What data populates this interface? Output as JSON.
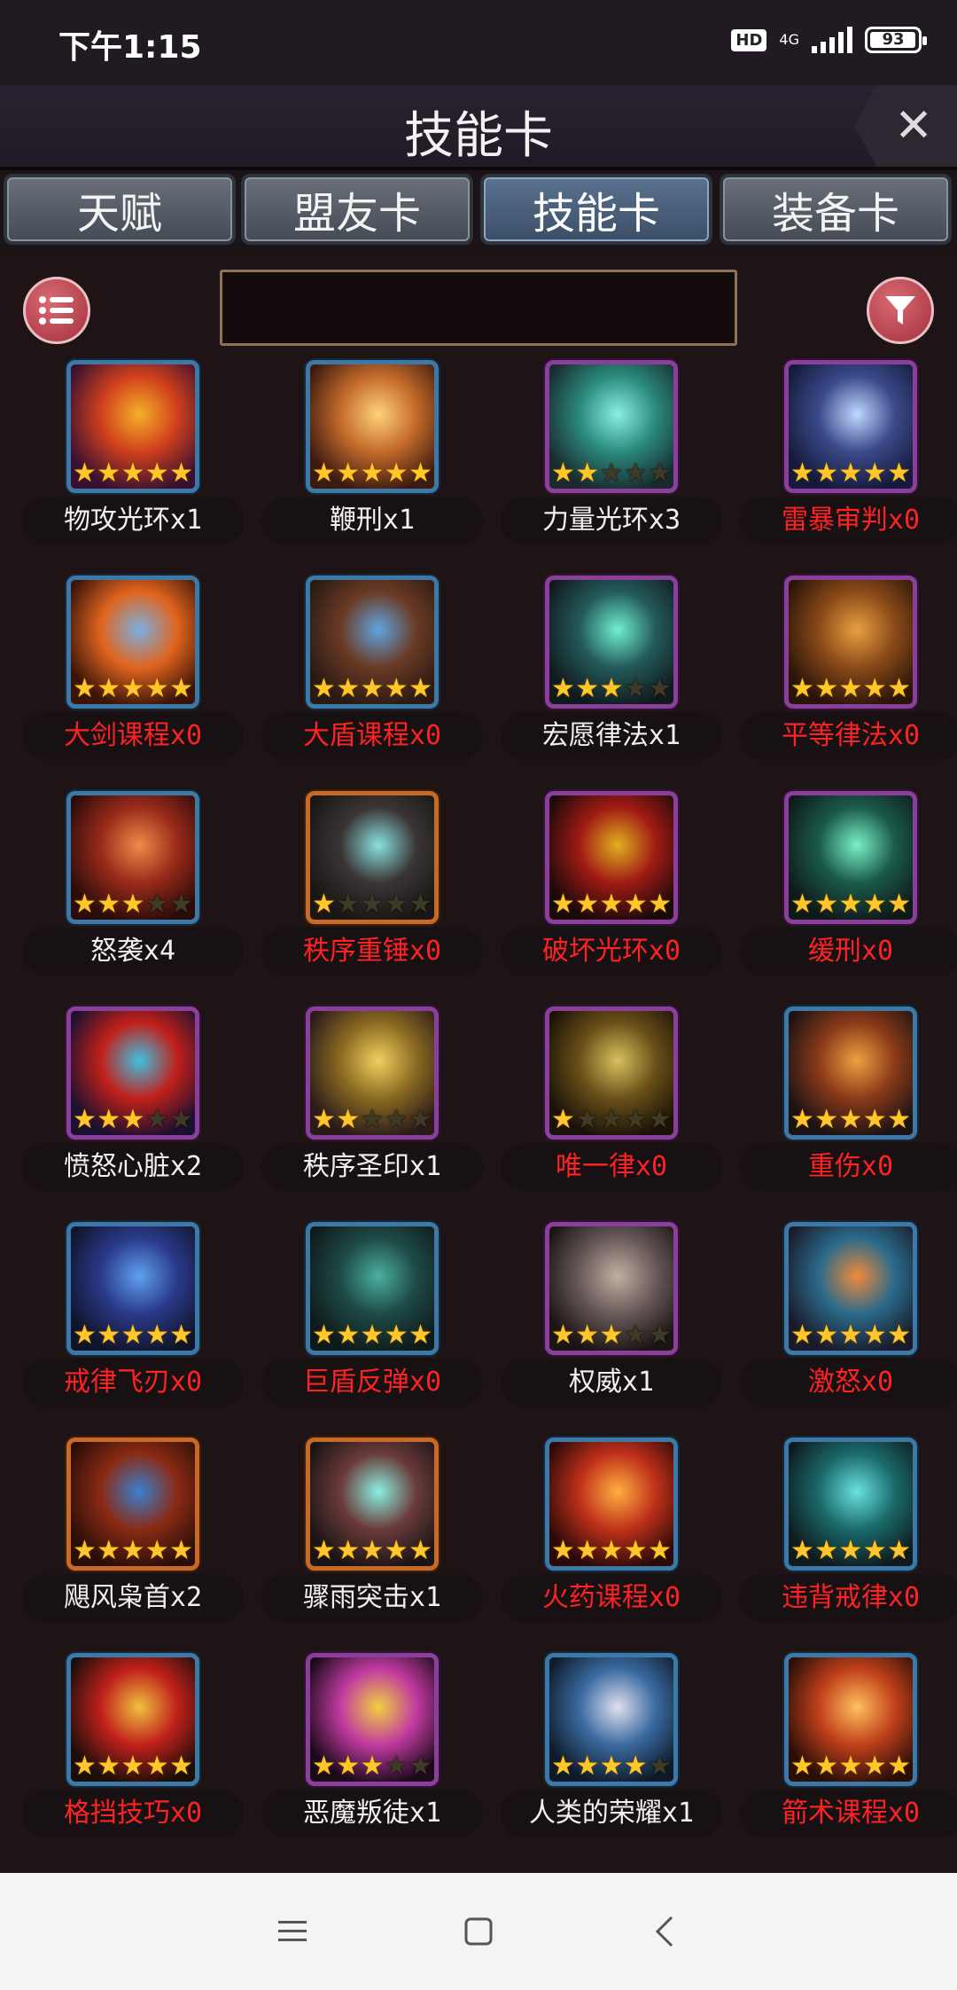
{
  "status": {
    "time": "下午1:15",
    "hd": "HD",
    "network": "4G",
    "battery": "93"
  },
  "header": {
    "title": "技能卡"
  },
  "tabs": [
    {
      "label": "天赋",
      "active": false
    },
    {
      "label": "盟友卡",
      "active": false
    },
    {
      "label": "技能卡",
      "active": true
    },
    {
      "label": "装备卡",
      "active": false
    }
  ],
  "search": {
    "value": ""
  },
  "cards": [
    {
      "name": "物攻光环x1",
      "stars": 5,
      "frame": "blue",
      "owned": true,
      "colors": [
        "#3a1030",
        "#d0401c",
        "#f5b02a"
      ]
    },
    {
      "name": "鞭刑x1",
      "stars": 5,
      "frame": "blue",
      "owned": true,
      "colors": [
        "#3b1a10",
        "#c46a2a",
        "#ffd27a"
      ]
    },
    {
      "name": "力量光环x3",
      "stars": 2,
      "frame": "purple",
      "owned": true,
      "colors": [
        "#1a2a2e",
        "#2a8a7e",
        "#8af0e4"
      ]
    },
    {
      "name": "雷暴审判x0",
      "stars": 5,
      "frame": "purple",
      "owned": false,
      "colors": [
        "#151a3a",
        "#3a4a8a",
        "#c0d8ff"
      ]
    },
    {
      "name": "大剑课程x0",
      "stars": 5,
      "frame": "blue",
      "owned": false,
      "colors": [
        "#3a1408",
        "#e0641e",
        "#7ab0e0"
      ]
    },
    {
      "name": "大盾课程x0",
      "stars": 5,
      "frame": "blue",
      "owned": false,
      "colors": [
        "#2a1a14",
        "#6a3a24",
        "#60a4e0"
      ]
    },
    {
      "name": "宏愿律法x1",
      "stars": 3,
      "frame": "purple",
      "owned": true,
      "colors": [
        "#101a1e",
        "#245a5a",
        "#6ef0d0"
      ]
    },
    {
      "name": "平等律法x0",
      "stars": 5,
      "frame": "purple",
      "owned": false,
      "colors": [
        "#2a1408",
        "#8a4a18",
        "#e8a040"
      ]
    },
    {
      "name": "怒袭x4",
      "stars": 3,
      "frame": "blue",
      "owned": true,
      "colors": [
        "#2a0c0a",
        "#9a2a1a",
        "#f08a4a"
      ]
    },
    {
      "name": "秩序重锤x0",
      "stars": 1,
      "frame": "orange",
      "owned": false,
      "colors": [
        "#1a1616",
        "#3a3434",
        "#8ae0e0"
      ]
    },
    {
      "name": "破坏光环x0",
      "stars": 5,
      "frame": "purple",
      "owned": false,
      "colors": [
        "#1a0a0a",
        "#a01a14",
        "#e0b020"
      ]
    },
    {
      "name": "缓刑x0",
      "stars": 5,
      "frame": "purple",
      "owned": false,
      "colors": [
        "#0e1a1a",
        "#1a5a4a",
        "#7af0c8"
      ]
    },
    {
      "name": "愤怒心脏x2",
      "stars": 3,
      "frame": "purple",
      "owned": true,
      "colors": [
        "#1a1030",
        "#c0201a",
        "#40c0e0"
      ]
    },
    {
      "name": "秩序圣印x1",
      "stars": 2,
      "frame": "purple",
      "owned": true,
      "colors": [
        "#2a1a1a",
        "#8a6a20",
        "#f0d060"
      ]
    },
    {
      "name": "唯一律x0",
      "stars": 1,
      "frame": "purple",
      "owned": false,
      "colors": [
        "#1a1208",
        "#6a5018",
        "#d8c060"
      ]
    },
    {
      "name": "重伤x0",
      "stars": 5,
      "frame": "blue",
      "owned": false,
      "colors": [
        "#1a1214",
        "#8a3a18",
        "#f0a040"
      ]
    },
    {
      "name": "戒律飞刃x0",
      "stars": 5,
      "frame": "blue",
      "owned": false,
      "colors": [
        "#10142a",
        "#2a3a8a",
        "#60a0f0"
      ]
    },
    {
      "name": "巨盾反弹x0",
      "stars": 5,
      "frame": "blue",
      "owned": false,
      "colors": [
        "#0e1a1a",
        "#1e4a46",
        "#4ab0a0"
      ]
    },
    {
      "name": "权威x1",
      "stars": 3,
      "frame": "purple",
      "owned": true,
      "colors": [
        "#1a1414",
        "#6a5a5a",
        "#c0b0a0"
      ]
    },
    {
      "name": "激怒x0",
      "stars": 5,
      "frame": "blue",
      "owned": false,
      "colors": [
        "#1a1a2a",
        "#2a6a8a",
        "#f08a3a"
      ]
    },
    {
      "name": "飓风枭首x2",
      "stars": 5,
      "frame": "orange",
      "owned": true,
      "colors": [
        "#2a0e08",
        "#8a2a14",
        "#3a80d0"
      ]
    },
    {
      "name": "骤雨突击x1",
      "stars": 5,
      "frame": "orange",
      "owned": true,
      "colors": [
        "#1a1414",
        "#6a3a3a",
        "#8af0e0"
      ]
    },
    {
      "name": "火药课程x0",
      "stars": 5,
      "frame": "blue",
      "owned": false,
      "colors": [
        "#2a0a08",
        "#c0301a",
        "#ffb040"
      ]
    },
    {
      "name": "违背戒律x0",
      "stars": 5,
      "frame": "blue",
      "owned": false,
      "colors": [
        "#0e1a1e",
        "#1a6a6a",
        "#6ae0e0"
      ]
    },
    {
      "name": "格挡技巧x0",
      "stars": 5,
      "frame": "blue",
      "owned": false,
      "colors": [
        "#1a0e0a",
        "#c0201a",
        "#f0c040"
      ]
    },
    {
      "name": "恶魔叛徒x1",
      "stars": 3,
      "frame": "purple",
      "owned": true,
      "colors": [
        "#1a0a1a",
        "#c03aa0",
        "#f0d040"
      ]
    },
    {
      "name": "人类的荣耀x1",
      "stars": 4,
      "frame": "blue",
      "owned": true,
      "colors": [
        "#0e1a2a",
        "#3a6aa0",
        "#e0e0f0"
      ]
    },
    {
      "name": "箭术课程x0",
      "stars": 5,
      "frame": "blue",
      "owned": false,
      "colors": [
        "#2a0e08",
        "#c0401a",
        "#ffc060"
      ]
    }
  ]
}
